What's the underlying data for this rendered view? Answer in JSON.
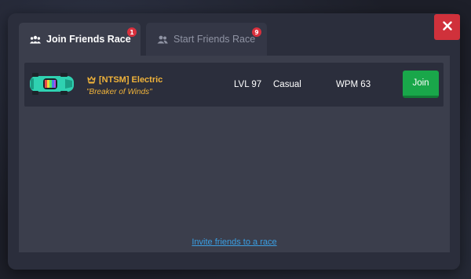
{
  "modal": {
    "tabs": [
      {
        "label": "Join Friends Race",
        "badge": "1",
        "icon": "group-icon",
        "active": true
      },
      {
        "label": "Start Friends Race",
        "badge": "9",
        "icon": "friends-icon",
        "active": false
      }
    ],
    "close_icon": "close-icon"
  },
  "friends": [
    {
      "crown_icon": "crown-icon",
      "name": "[NTSM] Electric",
      "title": "\"Breaker of Winds\"",
      "level": "LVL 97",
      "mode": "Casual",
      "wpm": "WPM 63",
      "join_label": "Join"
    }
  ],
  "invite_link": "Invite friends to a race",
  "colors": {
    "modal_bg": "#2b2e3c",
    "panel_bg": "#3b3e4c",
    "accent_gold": "#f0b33a",
    "join_green": "#19a74a",
    "close_red": "#d0313b",
    "badge_red": "#d9303d",
    "link_blue": "#3b9fe3"
  }
}
